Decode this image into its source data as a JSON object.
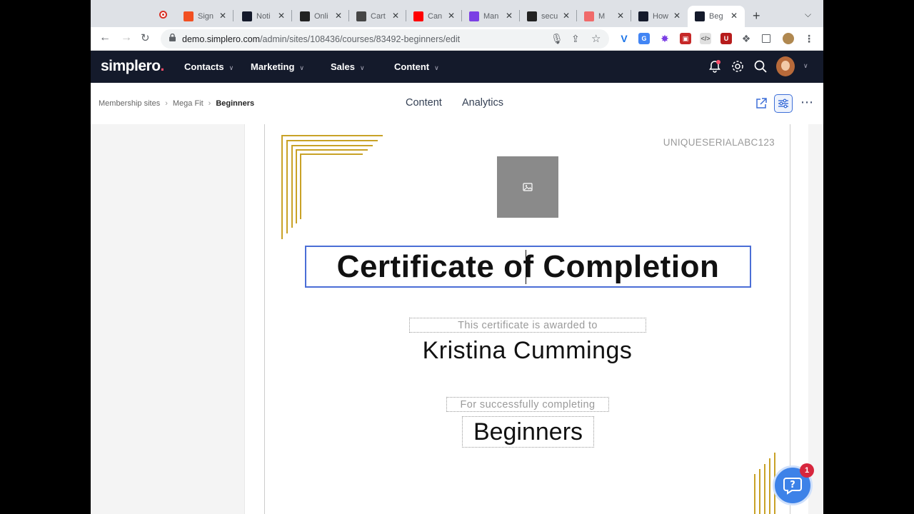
{
  "browser": {
    "tabs": [
      {
        "title": "Sign",
        "favicon": "microsoft-icon",
        "color": "#f25022"
      },
      {
        "title": "Noti",
        "favicon": "simplero-icon",
        "color": "#141a2b"
      },
      {
        "title": "Onli",
        "favicon": "amazon-icon",
        "color": "#222222"
      },
      {
        "title": "Cart",
        "favicon": "wordpress-icon",
        "color": "#464646"
      },
      {
        "title": "Can",
        "favicon": "youtube-icon",
        "color": "#ff0000"
      },
      {
        "title": "Man",
        "favicon": "tool-icon",
        "color": "#7b3fe4"
      },
      {
        "title": "secu",
        "favicon": "search-q-icon",
        "color": "#222222"
      },
      {
        "title": "M",
        "favicon": "asana-icon",
        "color": "#f06a6a"
      },
      {
        "title": "How",
        "favicon": "simplero-icon",
        "color": "#141a2b"
      },
      {
        "title": "Beg",
        "favicon": "simplero-icon",
        "color": "#141a2b"
      }
    ],
    "url_host": "demo.simplero.com",
    "url_path": "/admin/sites/108436/courses/83492-beginners/edit"
  },
  "app": {
    "logo": "simplero",
    "logo_dot": ".",
    "nav": [
      "Contacts",
      "Marketing",
      "Sales",
      "Content"
    ]
  },
  "breadcrumb": [
    "Membership sites",
    "Mega Fit",
    "Beginners"
  ],
  "editor_tabs": [
    "Content",
    "Analytics"
  ],
  "certificate": {
    "serial": "UNIQUESERIALABC123",
    "title": "Certificate of Completion",
    "awarded_label": "This certificate is awarded to",
    "awardee": "Kristina Cummings",
    "completing_label": "For successfully completing",
    "course": "Beginners"
  },
  "help_badge": "1",
  "colors": {
    "app_header": "#141a2b",
    "accent_blue": "#3d82e8",
    "gold": "#c9a227",
    "badge_red": "#d7263d"
  }
}
